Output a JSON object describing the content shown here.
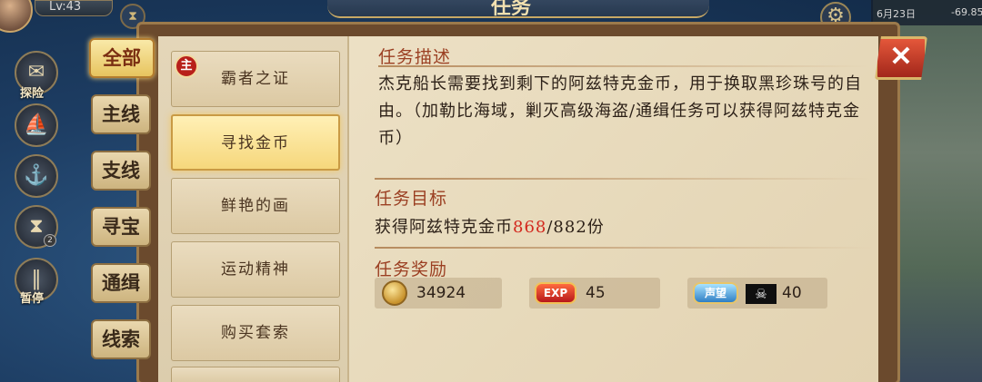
{
  "header": {
    "level": "Lv:43",
    "title": "任务",
    "date": "6月23日",
    "coord": "-69.85"
  },
  "sidebar": {
    "items": [
      {
        "label": "探险",
        "icon": "treasure-map-icon"
      },
      {
        "label": "",
        "icon": "ship-icon"
      },
      {
        "label": "",
        "icon": "anchor-icon"
      },
      {
        "label": "",
        "icon": "hourglass-icon",
        "badge": "2"
      },
      {
        "label": "暂停",
        "icon": "pause-icon"
      }
    ]
  },
  "categories": [
    {
      "label": "全部",
      "active": true
    },
    {
      "label": "主线",
      "active": false
    },
    {
      "label": "支线",
      "active": false
    },
    {
      "label": "寻宝",
      "active": false
    },
    {
      "label": "通缉",
      "active": false
    },
    {
      "label": "线索",
      "active": false
    }
  ],
  "quests": [
    {
      "name": "霸者之证",
      "badge": "主",
      "selected": false
    },
    {
      "name": "寻找金币",
      "selected": true
    },
    {
      "name": "鲜艳的画",
      "selected": false
    },
    {
      "name": "运动精神",
      "selected": false
    },
    {
      "name": "购买套索",
      "selected": false
    }
  ],
  "detail": {
    "desc_title": "任务描述",
    "desc": "杰克船长需要找到剩下的阿兹特克金币，用于换取黑珍珠号的自由。（加勒比海域，剿灭高级海盗/通缉任务可以获得阿兹特克金币）",
    "goal_title": "任务目标",
    "goal_prefix": "获得阿兹特克金币",
    "goal_current": "868",
    "goal_suffix": "/882份",
    "reward_title": "任务奖励",
    "rewards": {
      "coins": "34924",
      "exp_label": "EXP",
      "exp": "45",
      "reputation_label": "声望",
      "reputation": "40"
    }
  },
  "colors": {
    "accent_red": "#d3281e",
    "title_brown": "#9b3f22"
  }
}
